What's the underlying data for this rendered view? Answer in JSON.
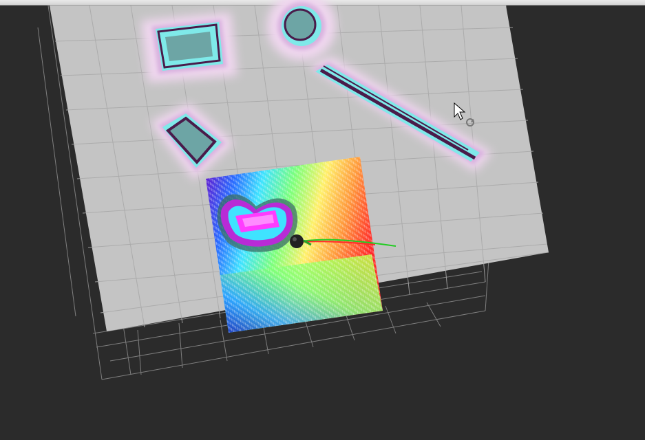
{
  "scene": {
    "background_color": "#2b2b2b",
    "grid_line_color": "#8e8e8e",
    "static_map_free_color": "#c4c4c4",
    "obstacle_color": "#4a1b4a",
    "inflation_colors": [
      "#7fe9e9",
      "#d9b3df",
      "#f0d7ef"
    ],
    "local_costmap_gradient": [
      "#6a12c8",
      "#2a6cff",
      "#3fe3ff",
      "#7dff7a",
      "#fff06a",
      "#ff9a3c",
      "#ff2a2a"
    ],
    "global_path_color": "#22cc22",
    "local_path_color": "#ff2a2a",
    "robot_color": "#222222"
  },
  "cursor": {
    "icon": "rotate-cursor-icon"
  }
}
